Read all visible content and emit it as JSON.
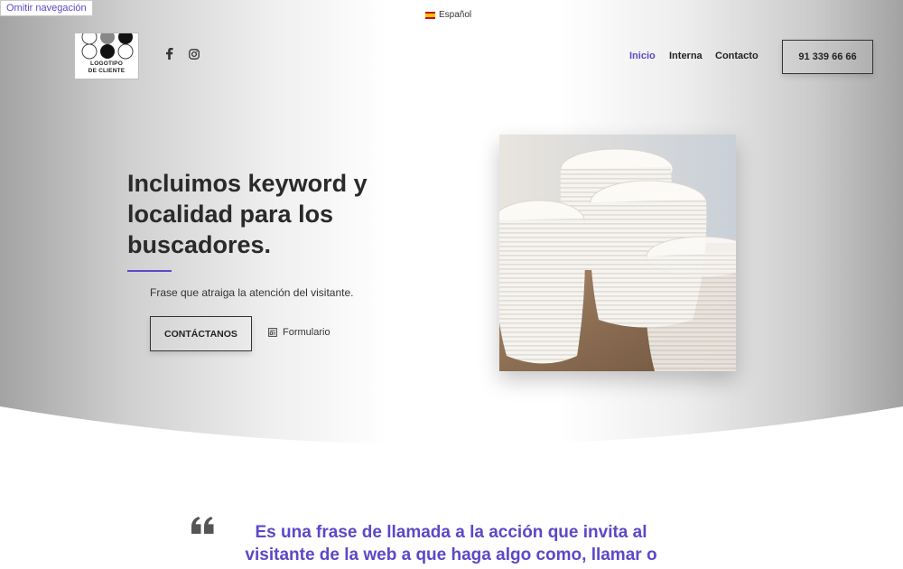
{
  "skip_link": "Omitir navegación",
  "language": {
    "label": "Español",
    "flag_icon": "spain-flag-icon"
  },
  "logo": {
    "line1": "LOGOTIPO",
    "line2": "DE CLIENTE"
  },
  "social": [
    "facebook-icon",
    "instagram-icon"
  ],
  "nav": {
    "items": [
      {
        "label": "Inicio",
        "active": true
      },
      {
        "label": "Interna",
        "active": false
      },
      {
        "label": "Contacto",
        "active": false
      }
    ],
    "phone": "91 339 66 66"
  },
  "hero": {
    "headline": "Incluimos keyword y localidad para los buscadores.",
    "subtitle": "Frase que atraiga la atención del visitante.",
    "cta_label": "CONTÁCTANOS",
    "form_link": "Formulario",
    "form_icon": "form-icon"
  },
  "quote": {
    "icon": "quote-icon",
    "text": "Es una frase de llamada a la acción que invita al visitante de la web a que haga algo como, llamar o"
  },
  "colors": {
    "accent": "#5b49c7",
    "text": "#222222"
  }
}
